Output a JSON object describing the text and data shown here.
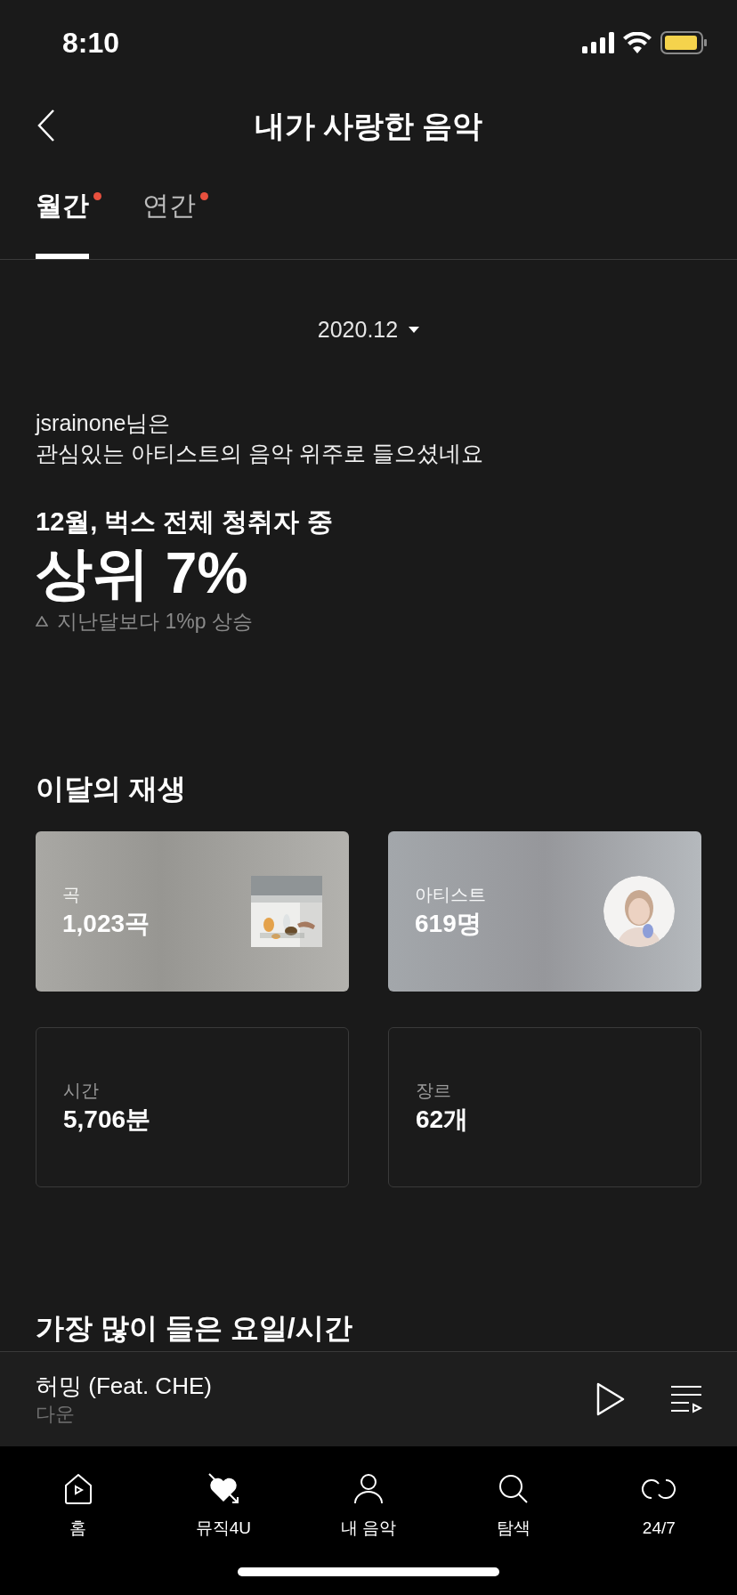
{
  "status_bar": {
    "time": "8:10"
  },
  "header": {
    "title": "내가 사랑한 음악"
  },
  "tabs": [
    {
      "label": "월간",
      "selected": true,
      "new": true
    },
    {
      "label": "연간",
      "selected": false,
      "new": true
    }
  ],
  "period": {
    "value": "2020.12"
  },
  "summary": {
    "user_line": "jsrainone님은",
    "description": "관심있는 아티스트의 음악 위주로 들으셨네요",
    "rank_caption": "12월, 벅스 전체 청취자 중",
    "rank": "상위 7%",
    "change": "지난달보다 1%p 상승"
  },
  "stats_section": {
    "title": "이달의 재생",
    "cards": [
      {
        "kind": "square-art",
        "label": "곡",
        "value": "1,023곡"
      },
      {
        "kind": "round-art",
        "label": "아티스트",
        "value": "619명"
      },
      {
        "kind": "outline",
        "label": "시간",
        "value": "5,706분"
      },
      {
        "kind": "outline",
        "label": "장르",
        "value": "62개"
      }
    ]
  },
  "next_section": {
    "title": "가장 많이 들은 요일/시간"
  },
  "mini_player": {
    "title": "허밍 (Feat. CHE)",
    "artist": "다운"
  },
  "tab_bar": [
    {
      "kind": "home",
      "label": "홈"
    },
    {
      "kind": "heart",
      "label": "뮤직4U"
    },
    {
      "kind": "person",
      "label": "내 음악"
    },
    {
      "kind": "search",
      "label": "탐색"
    },
    {
      "kind": "loop",
      "label": "24/7"
    }
  ]
}
